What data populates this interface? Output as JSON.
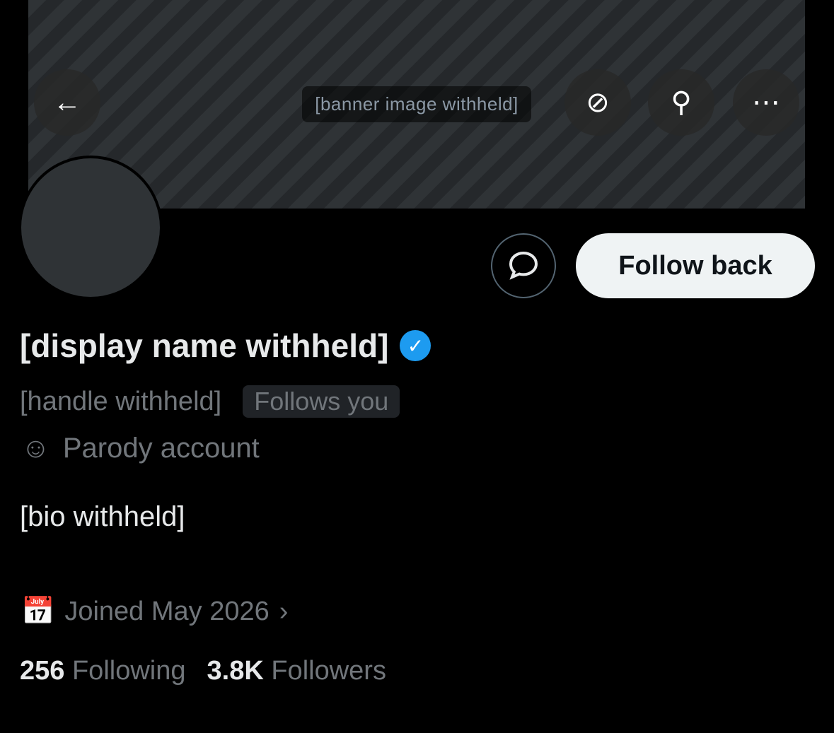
{
  "banner": {
    "placeholder": "[banner image withheld]"
  },
  "profile": {
    "display_name": "[display name withheld]",
    "handle": "[handle withheld]",
    "follows_you": "Follows you",
    "parody": "Parody account",
    "bio": "[bio withheld]",
    "joined": "Joined May 2026",
    "following_count": "256",
    "following_label": "Following",
    "followers_count": "3.8K",
    "followers_label": "Followers"
  },
  "actions": {
    "follow_back": "Follow back"
  },
  "colors": {
    "verified": "#1d9bf0",
    "background": "#000000",
    "muted": "#71767b"
  },
  "icons": [
    "back-arrow-icon",
    "grok-icon",
    "search-icon",
    "more-icon",
    "message-icon",
    "verified-icon",
    "parody-mask-icon",
    "calendar-icon",
    "chevron-right-icon"
  ]
}
